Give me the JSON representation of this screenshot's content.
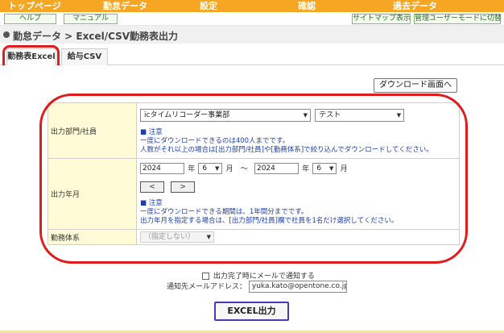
{
  "nav": {
    "items": [
      "トップページ",
      "勤怠データ",
      "設定",
      "確認",
      "過去データ"
    ]
  },
  "subbar": {
    "help": "ヘルプ",
    "manual": "マニュアル",
    "sitemap": "サイトマップ表示",
    "admin_switch": "管理ユーザーモードに切替"
  },
  "breadcrumb": "勤怠データ > Excel/CSV勤務表出力",
  "tabs": [
    {
      "label": "勤務表Excel",
      "active": true
    },
    {
      "label": "給与CSV",
      "active": false
    }
  ],
  "download_button": "ダウンロード画面へ",
  "form": {
    "dept": {
      "label": "出力部門/社員",
      "dept_selected": "icタイムリコーダー事業部",
      "employee_selected": "テスト",
      "note_title": "■ 注意",
      "note_line1": "一度にダウンロードできるのは400人までです。",
      "note_line2": "人数がそれ以上の場合は[出力部門/社員]や[勤務体系]で絞り込んでダウンロードしてください。"
    },
    "period": {
      "label": "出力年月",
      "from_year": "2024",
      "from_month": "6",
      "to_year": "2024",
      "to_month": "6",
      "year_unit": "年",
      "month_unit": "月",
      "tilde": "～",
      "prev": "<",
      "next": ">",
      "note_title": "■ 注意",
      "note_line1": "一度にダウンロードできる期間は、1年間分までです。",
      "note_line2": "出力年月を指定する場合は、[出力部門/社員]欄で社員を1名だけ選択してください。"
    },
    "schedule": {
      "label": "勤務体系",
      "selected": "（指定しない）"
    }
  },
  "notify": {
    "checkbox_label": "出力完了時にメールで通知する",
    "mail_label": "通知先メールアドレス：",
    "mail_value": "yuka.kato@opentone.co.jp"
  },
  "excel_button": "EXCEL出力",
  "colors": {
    "nav_bg": "#f6a623",
    "label_bg": "#fffbd6",
    "note_text": "#1c3fae",
    "annotation_ring": "#e01b1b"
  }
}
